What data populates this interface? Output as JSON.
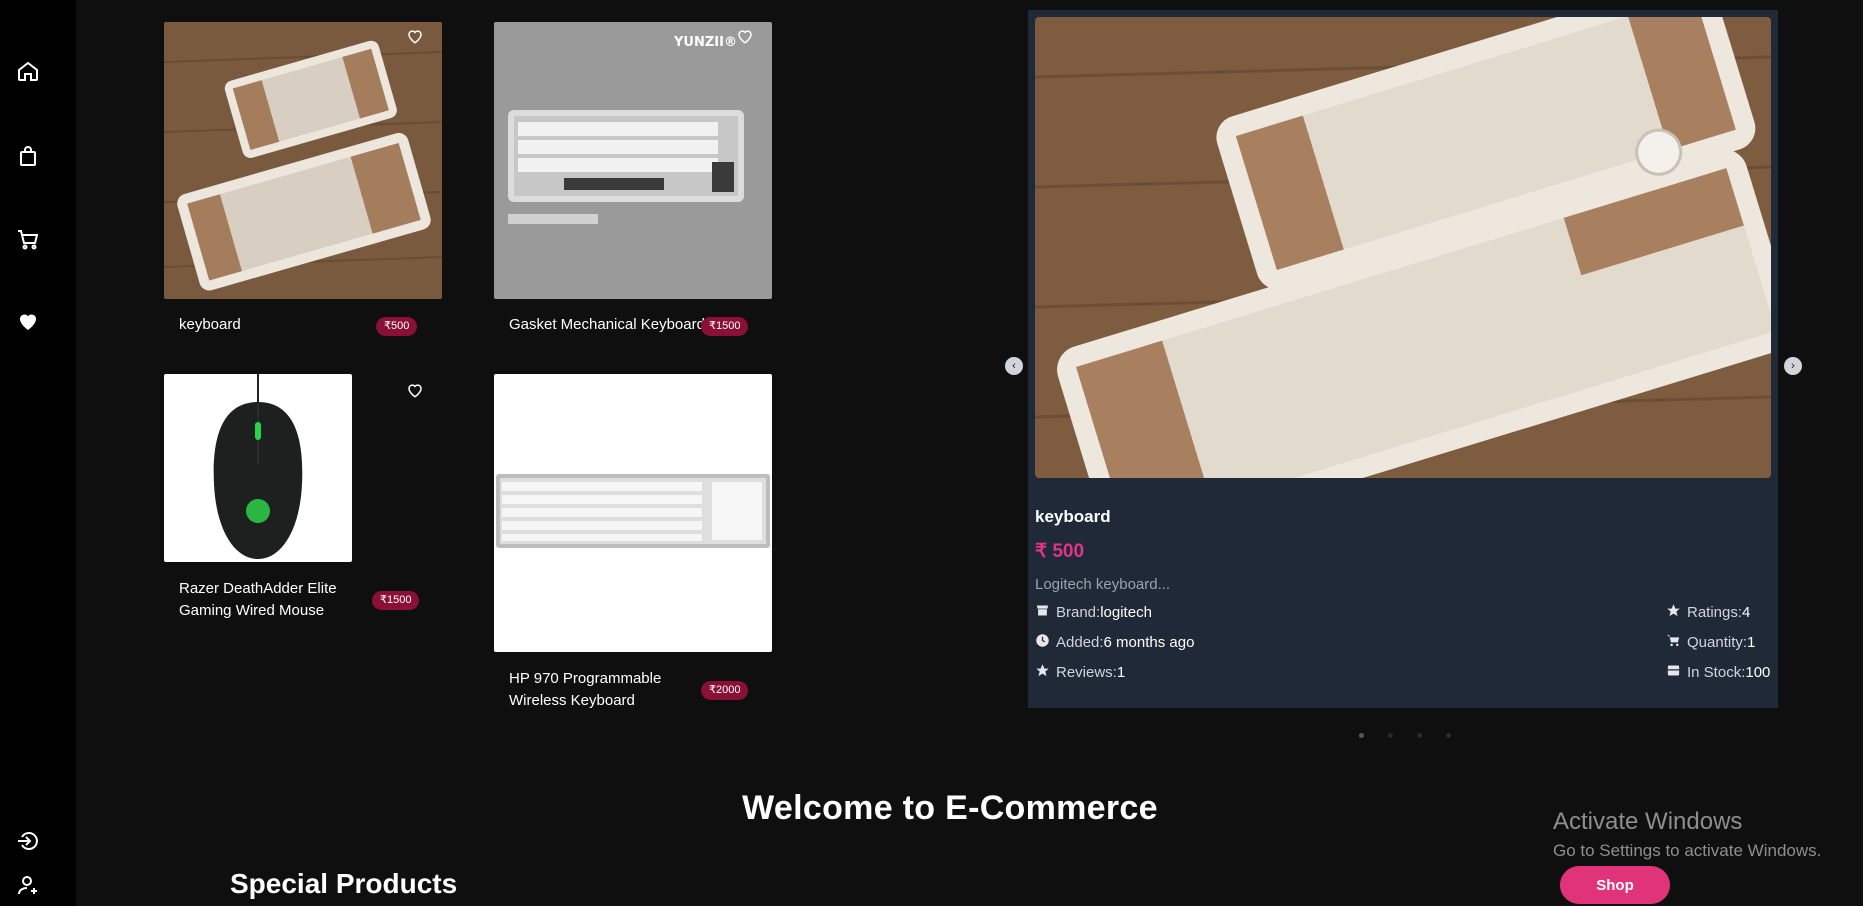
{
  "sidebar": {
    "icons": [
      "home-icon",
      "bag-icon",
      "cart-icon",
      "heart-icon",
      "login-icon",
      "user-icon"
    ]
  },
  "products": [
    {
      "name": "keyboard",
      "price": "₹500"
    },
    {
      "name": "Gasket Mechanical Keyboard",
      "price": "₹1500",
      "brand_logo": "YUNZII®"
    },
    {
      "name_line1": "Razer DeathAdder Elite",
      "name_line2": "Gaming Wired Mouse",
      "price": "₹1500"
    },
    {
      "name_line1": "HP 970 Programmable",
      "name_line2": "Wireless Keyboard",
      "price": "₹2000"
    }
  ],
  "detail": {
    "title": "keyboard",
    "price": "₹ 500",
    "description": "Logitech keyboard...",
    "brand_label": "Brand:",
    "brand_value": "logitech",
    "added_label": "Added:",
    "added_value": "6 months ago",
    "reviews_label": "Reviews:",
    "reviews_value": "1",
    "ratings_label": "Ratings:",
    "ratings_value": "4",
    "quantity_label": "Quantity:",
    "quantity_value": "1",
    "stock_label": "In Stock:",
    "stock_value": "100"
  },
  "carousel": {
    "prev": "‹",
    "next": "›",
    "dots": 4,
    "active_dot": 0
  },
  "welcome": "Welcome to E-Commerce",
  "special": "Special Products",
  "watermark": {
    "title": "Activate Windows",
    "subtitle": "Go to Settings to activate Windows."
  },
  "shop_button": "Shop",
  "colors": {
    "accent": "#e0337a",
    "badge": "#8a1038",
    "panel": "#1f2937"
  }
}
